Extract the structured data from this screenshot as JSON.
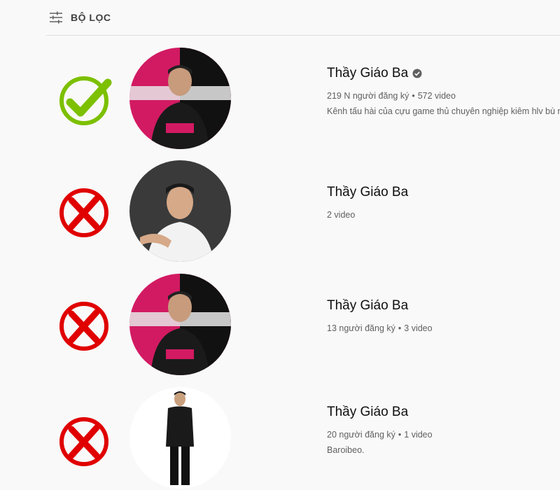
{
  "filter": {
    "label": "BỘ LỌC",
    "icon": "sliders-icon"
  },
  "colors": {
    "check": "#7cc000",
    "cross": "#e00000",
    "text_primary": "#0f0f0f",
    "text_secondary": "#606060"
  },
  "results": [
    {
      "status": "correct",
      "avatar": "pink-black-gamer-avatar",
      "name": "Thầy Giáo Ba",
      "verified": true,
      "subscribers": "219 N người đăng ký",
      "videos": "572 video",
      "description": "Kênh tấu hài của cựu game thủ chuyên nghiệp kiêm hlv bù n"
    },
    {
      "status": "wrong",
      "avatar": "gray-portrait-avatar",
      "name": "Thầy Giáo Ba",
      "verified": false,
      "subscribers": "",
      "videos": "2 video",
      "description": ""
    },
    {
      "status": "wrong",
      "avatar": "pink-black-gamer-avatar",
      "name": "Thầy Giáo Ba",
      "verified": false,
      "subscribers": "13 người đăng ký",
      "videos": "3 video",
      "description": ""
    },
    {
      "status": "wrong",
      "avatar": "white-standing-man-avatar",
      "name": "Thầy Giáo Ba",
      "verified": false,
      "subscribers": "20 người đăng ký",
      "videos": "1 video",
      "description": "Baroibeo."
    }
  ]
}
